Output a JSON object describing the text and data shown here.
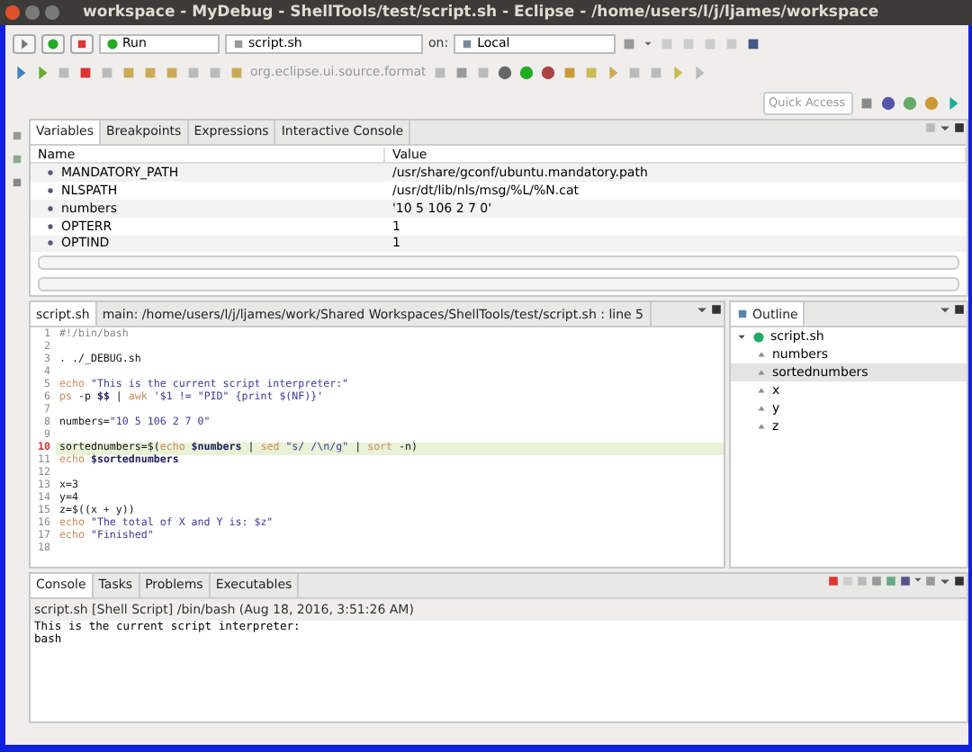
{
  "window": {
    "title": "workspace - MyDebug - ShellTools/test/script.sh - Eclipse - /home/users/l/j/ljames/workspace"
  },
  "toolbar": {
    "launch_mode": "Run",
    "launch_config": "script.sh",
    "on_label": "on:",
    "target": "Local",
    "format_command": "org.eclipse.ui.source.format",
    "quick_access": {
      "placeholder": "Quick Access"
    }
  },
  "variables_view": {
    "tabs": [
      {
        "label": "Variables",
        "selected": true
      },
      {
        "label": "Breakpoints",
        "selected": false
      },
      {
        "label": "Expressions",
        "selected": false
      },
      {
        "label": "Interactive Console",
        "selected": false
      }
    ],
    "columns": [
      "Name",
      "Value"
    ],
    "rows": [
      {
        "name": "MANDATORY_PATH",
        "value": "/usr/share/gconf/ubuntu.mandatory.path"
      },
      {
        "name": "NLSPATH",
        "value": "/usr/dt/lib/nls/msg/%L/%N.cat"
      },
      {
        "name": "numbers",
        "value": "'10 5 106 2 7 0'"
      },
      {
        "name": "OPTERR",
        "value": "1"
      },
      {
        "name": "OPTIND",
        "value": "1"
      }
    ]
  },
  "editor": {
    "tabs": [
      {
        "label": "script.sh",
        "selected": true
      },
      {
        "label": "main:  /home/users/l/j/ljames/work/Shared Workspaces/ShellTools/test/script.sh  : line 5",
        "selected": false
      }
    ],
    "lines": [
      {
        "number": "1",
        "current": false,
        "breakpoint": false,
        "tokens": [
          {
            "kind": "comment",
            "text": "#!/bin/bash"
          }
        ]
      },
      {
        "number": "2",
        "current": false,
        "breakpoint": false
      },
      {
        "number": "3",
        "current": false,
        "breakpoint": false,
        "tokens": [
          {
            "kind": "plain",
            "text": ". ./_DEBUG.sh"
          }
        ]
      },
      {
        "number": "4",
        "current": false,
        "breakpoint": false
      },
      {
        "number": "5",
        "current": false,
        "breakpoint": false,
        "tokens": [
          {
            "kind": "keyword",
            "text": "echo"
          },
          {
            "kind": "string",
            "text": " \"This is the current script interpreter:\""
          }
        ]
      },
      {
        "number": "6",
        "current": false,
        "breakpoint": false,
        "tokens": [
          {
            "kind": "keyword",
            "text": "ps"
          },
          {
            "kind": "plain",
            "text": " -p "
          },
          {
            "kind": "variable",
            "text": "$$"
          },
          {
            "kind": "plain",
            "text": " | "
          },
          {
            "kind": "keyword",
            "text": "awk"
          },
          {
            "kind": "string",
            "text": " '$1 != \"PID\" {print $(NF)}'"
          }
        ]
      },
      {
        "number": "7",
        "current": false,
        "breakpoint": false
      },
      {
        "number": "8",
        "current": false,
        "breakpoint": false,
        "tokens": [
          {
            "kind": "plain",
            "text": "numbers="
          },
          {
            "kind": "string",
            "text": "\"10 5 106 2 7 0\""
          }
        ]
      },
      {
        "number": "9",
        "current": false,
        "breakpoint": false
      },
      {
        "number": "10",
        "current": true,
        "breakpoint": true,
        "tokens": [
          {
            "kind": "plain",
            "text": "sortednumbers=$("
          },
          {
            "kind": "keyword",
            "text": "echo"
          },
          {
            "kind": "variable",
            "text": " $numbers"
          },
          {
            "kind": "plain",
            "text": " | "
          },
          {
            "kind": "keyword",
            "text": "sed"
          },
          {
            "kind": "string",
            "text": " \"s/ /\\n/g\""
          },
          {
            "kind": "plain",
            "text": " | "
          },
          {
            "kind": "keyword",
            "text": "sort"
          },
          {
            "kind": "plain",
            "text": " -n)"
          }
        ]
      },
      {
        "number": "11",
        "current": false,
        "breakpoint": false,
        "tokens": [
          {
            "kind": "keyword",
            "text": "echo"
          },
          {
            "kind": "variable",
            "text": " $sortednumbers"
          }
        ]
      },
      {
        "number": "12",
        "current": false,
        "breakpoint": false
      },
      {
        "number": "13",
        "current": false,
        "breakpoint": false,
        "tokens": [
          {
            "kind": "plain",
            "text": "x=3"
          }
        ]
      },
      {
        "number": "14",
        "current": false,
        "breakpoint": false,
        "tokens": [
          {
            "kind": "plain",
            "text": "y=4"
          }
        ]
      },
      {
        "number": "15",
        "current": false,
        "breakpoint": false,
        "tokens": [
          {
            "kind": "plain",
            "text": "z=$((x + y))"
          }
        ]
      },
      {
        "number": "16",
        "current": false,
        "breakpoint": false,
        "tokens": [
          {
            "kind": "keyword",
            "text": "echo"
          },
          {
            "kind": "string",
            "text": " \"The total of X and Y is: $z\""
          }
        ]
      },
      {
        "number": "17",
        "current": false,
        "breakpoint": false,
        "tokens": [
          {
            "kind": "keyword",
            "text": "echo"
          },
          {
            "kind": "string",
            "text": " \"Finished\""
          }
        ]
      },
      {
        "number": "18",
        "current": false,
        "breakpoint": false
      }
    ]
  },
  "outline": {
    "title": "Outline",
    "root": {
      "label": "script.sh",
      "expanded": true,
      "children": [
        {
          "label": "numbers",
          "selected": false
        },
        {
          "label": "sortednumbers",
          "selected": true
        },
        {
          "label": "x",
          "selected": false
        },
        {
          "label": "y",
          "selected": false
        },
        {
          "label": "z",
          "selected": false
        }
      ]
    }
  },
  "console": {
    "tabs": [
      {
        "label": "Console",
        "selected": true
      },
      {
        "label": "Tasks",
        "selected": false
      },
      {
        "label": "Problems",
        "selected": false
      },
      {
        "label": "Executables",
        "selected": false
      }
    ],
    "process": "script.sh [Shell Script] /bin/bash (Aug 18, 2016, 3:51:26 AM)",
    "output": [
      "This is the current script interpreter:",
      "bash"
    ]
  }
}
